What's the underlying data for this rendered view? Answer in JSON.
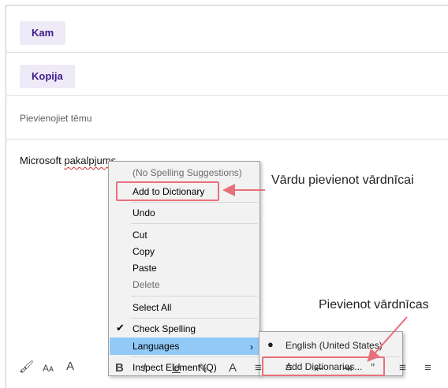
{
  "compose": {
    "to_label": "Kam",
    "cc_label": "Kopija",
    "subject_placeholder": "Pievienojiet tēmu",
    "body_text_prefix": "Microsoft ",
    "body_text_misspelled": "pakalpjums"
  },
  "context_menu": {
    "no_suggestions": "(No Spelling Suggestions)",
    "add_to_dictionary": "Add to Dictionary",
    "undo": "Undo",
    "cut": "Cut",
    "copy": "Copy",
    "paste": "Paste",
    "delete": "Delete",
    "select_all": "Select All",
    "check_spelling": "Check Spelling",
    "languages": "Languages",
    "inspect_element": "Inspect Element (Q)"
  },
  "languages_submenu": {
    "english": "English (United States)",
    "add_dictionaries": "Add Dictionaries..."
  },
  "callouts": {
    "add_word": "Vārdu pievienot vārdnīcai",
    "add_dictionaries": "Pievienot vārdnīcas"
  },
  "toolbar_icons": [
    "format-painter-icon",
    "font-size-icon",
    "font-color-grow-icon",
    "bold-icon",
    "italic-icon",
    "underline-icon",
    "highlight-icon",
    "font-color-icon",
    "bullets-icon",
    "numbering-icon",
    "decrease-indent-icon",
    "increase-indent-icon",
    "quote-icon",
    "align-left-icon",
    "align-center-icon"
  ],
  "colors": {
    "accent_purple": "#3b1a8a",
    "callout_red": "#e8707a",
    "menu_highlight": "#91c9f7"
  }
}
